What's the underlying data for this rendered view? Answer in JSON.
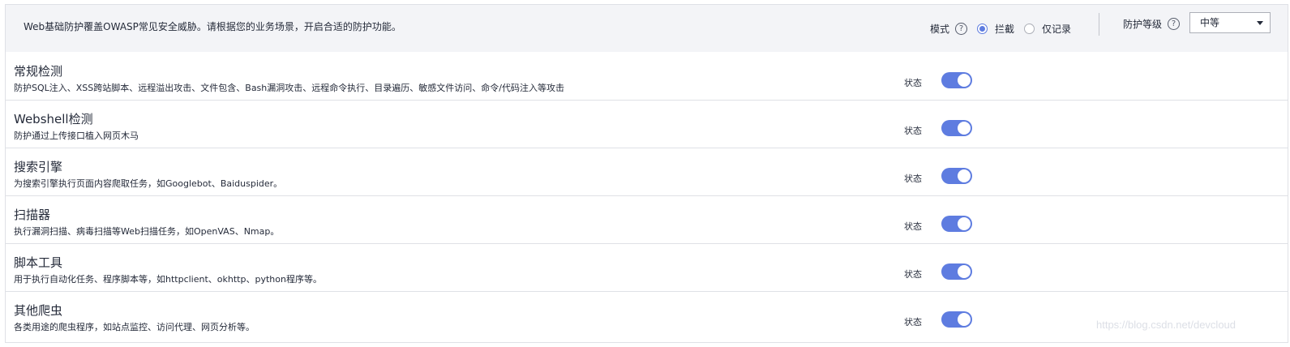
{
  "header": {
    "description": "Web基础防护覆盖OWASP常见安全威胁。请根据您的业务场景，开启合适的防护功能。",
    "mode_label": "模式",
    "mode_options": [
      {
        "label": "拦截",
        "selected": true
      },
      {
        "label": "仅记录",
        "selected": false
      }
    ],
    "level_label": "防护等级",
    "level_value": "中等",
    "help_glyph": "?"
  },
  "rules": [
    {
      "title": "常规检测",
      "desc": "防护SQL注入、XSS跨站脚本、远程溢出攻击、文件包含、Bash漏洞攻击、远程命令执行、目录遍历、敏感文件访问、命令/代码注入等攻击",
      "status_label": "状态",
      "enabled": true
    },
    {
      "title": "Webshell检测",
      "desc": "防护通过上传接口植入网页木马",
      "status_label": "状态",
      "enabled": true
    },
    {
      "title": "搜索引擎",
      "desc": "为搜索引擎执行页面内容爬取任务，如Googlebot、Baiduspider。",
      "status_label": "状态",
      "enabled": true
    },
    {
      "title": "扫描器",
      "desc": "执行漏洞扫描、病毒扫描等Web扫描任务，如OpenVAS、Nmap。",
      "status_label": "状态",
      "enabled": true
    },
    {
      "title": "脚本工具",
      "desc": "用于执行自动化任务、程序脚本等，如httpclient、okhttp、python程序等。",
      "status_label": "状态",
      "enabled": true
    },
    {
      "title": "其他爬虫",
      "desc": "各类用途的爬虫程序，如站点监控、访问代理、网页分析等。",
      "status_label": "状态",
      "enabled": true
    }
  ],
  "watermark": "https://blog.csdn.net/devcloud",
  "colors": {
    "accent": "#5e7ce0",
    "topbar_bg": "#f3f4f7",
    "border": "#dfe1e6"
  }
}
